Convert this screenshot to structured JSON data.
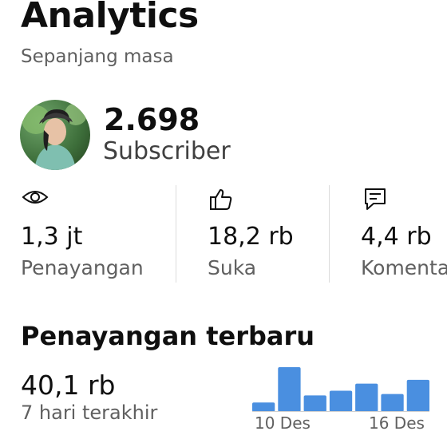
{
  "header": {
    "title": "Analytics",
    "subtitle": "Sepanjang masa"
  },
  "channel": {
    "subscriber_count": "2.698",
    "subscriber_label": "Subscriber"
  },
  "stats": [
    {
      "icon": "eye-icon",
      "value": "1,3 jt",
      "label": "Penayangan"
    },
    {
      "icon": "thumbs-up-icon",
      "value": "18,2 rb",
      "label": "Suka"
    },
    {
      "icon": "comment-icon",
      "value": "4,4 rb",
      "label": "Komentar"
    }
  ],
  "recent_views": {
    "title": "Penayangan terbaru",
    "value": "40,1 rb",
    "period": "7 hari terakhir",
    "chart_data": {
      "type": "bar",
      "values": [
        2.0,
        9.5,
        3.5,
        4.5,
        6.0,
        3.8,
        6.8
      ],
      "x_start_label": "10 Des",
      "x_end_label": "16 Des",
      "bar_color": "#4a8fe0"
    }
  }
}
